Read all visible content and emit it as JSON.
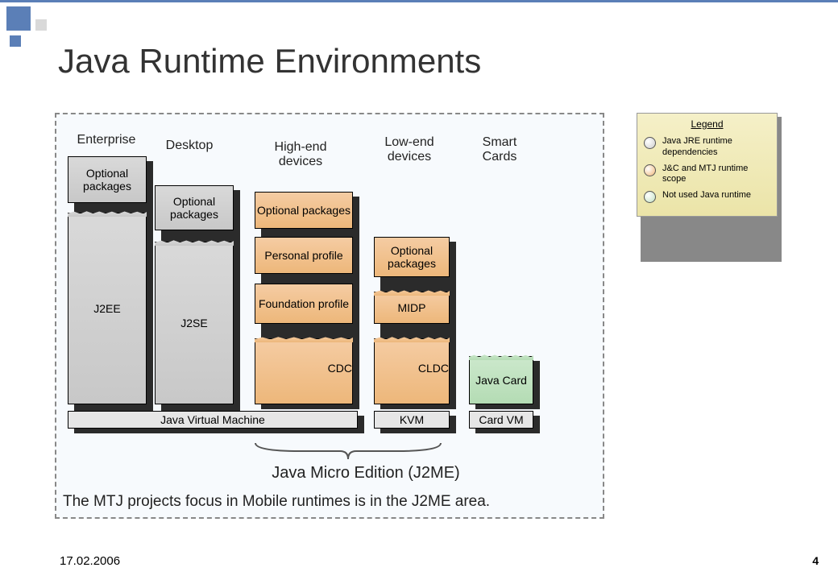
{
  "title": "Java Runtime Environments",
  "columns": {
    "enterprise": "Enterprise",
    "desktop": "Desktop",
    "highend": "High-end devices",
    "lowend": "Low-end devices",
    "smartcards": "Smart Cards"
  },
  "blocks": {
    "opt_pkg": "Optional packages",
    "j2ee": "J2EE",
    "j2se": "J2SE",
    "personal_profile": "Personal profile",
    "foundation_profile": "Foundation profile",
    "cdc": "CDC",
    "jvm": "Java Virtual Machine",
    "midp": "MIDP",
    "cldc": "CLDC",
    "kvm": "KVM",
    "java_card": "Java Card",
    "card_vm": "Card VM"
  },
  "j2me_label": "Java Micro Edition (J2ME)",
  "bottom_text": "The MTJ projects focus in Mobile runtimes is in the J2ME area.",
  "legend": {
    "title": "Legend",
    "jre": "Java JRE runtime dependencies",
    "mtj": "J&C and MTJ runtime scope",
    "notused": "Not used Java runtime"
  },
  "date": "17.02.2006",
  "page": "4"
}
